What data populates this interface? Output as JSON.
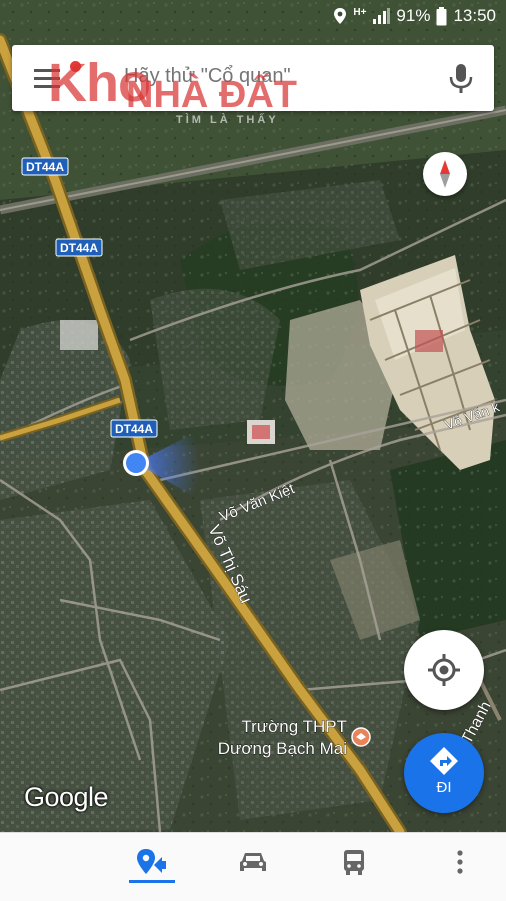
{
  "status_bar": {
    "network_label": "H+",
    "battery": "91%",
    "time": "13:50"
  },
  "search": {
    "placeholder": "Hãy thử \"Cổ quan\""
  },
  "watermark": {
    "line1": "Kho",
    "line2": "NHÀ ĐẤT",
    "line3": "TÌM LÀ THẤY"
  },
  "map": {
    "road_badges": [
      "DT44A",
      "DT44A",
      "DT44A"
    ],
    "labels": {
      "vo_van_kiet_1": "Võ Văn Kiệt",
      "vo_van_kiet_2": "Võ Văn k",
      "vo_thi_sau": "Võ Thị Sáu",
      "thanh": "Thanh",
      "school_line1": "Trường THPT",
      "school_line2": "Dương Bạch Mai"
    },
    "attribution": "Google"
  },
  "buttons": {
    "go_label": "ĐI"
  },
  "bottom_nav": {
    "items": [
      "explore-tab",
      "driving-tab",
      "transit-tab",
      "more-menu"
    ],
    "active": "explore-tab"
  },
  "colors": {
    "accent": "#1a73e8",
    "road": "#c9a13f",
    "badge_bg": "#1f5fb8"
  }
}
